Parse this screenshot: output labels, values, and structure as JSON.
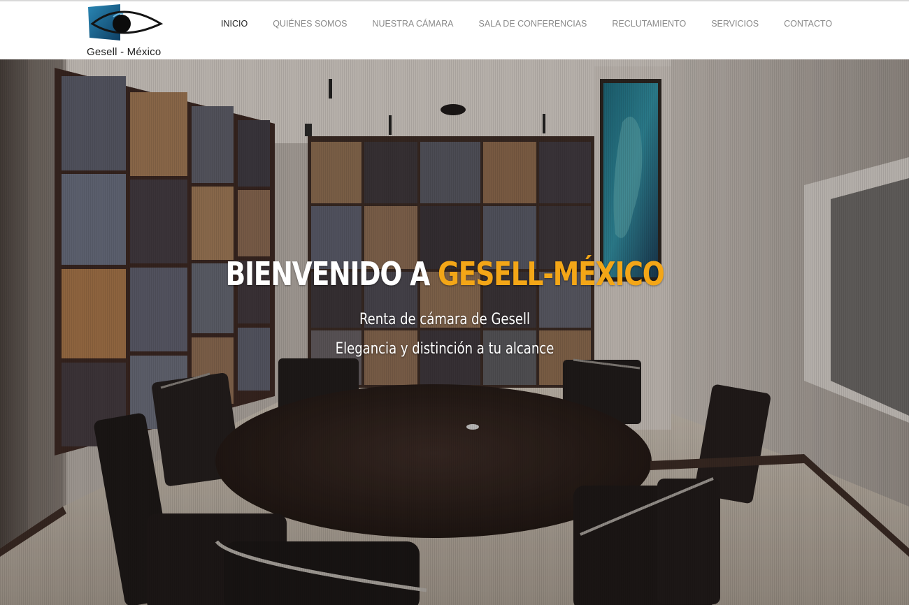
{
  "logo": {
    "text": "Gesell - México",
    "icon": "eye-logo-icon"
  },
  "nav": {
    "items": [
      {
        "label": "INICIO",
        "active": true
      },
      {
        "label": "QUIÉNES SOMOS",
        "active": false
      },
      {
        "label": "NUESTRA CÁMARA",
        "active": false
      },
      {
        "label": "SALA DE CONFERENCIAS",
        "active": false
      },
      {
        "label": "RECLUTAMIENTO",
        "active": false
      },
      {
        "label": "SERVICIOS",
        "active": false
      },
      {
        "label": "CONTACTO",
        "active": false
      }
    ]
  },
  "hero": {
    "title_prefix": "BIENVENIDO A ",
    "title_accent": "GESELL-MÉXICO",
    "line1": "Renta de cámara de Gesell",
    "line2": "Elegancia y distinción a tu alcance",
    "background": "conference-room-photo"
  },
  "colors": {
    "accent": "#f3a617",
    "nav_text": "#8a8a8a",
    "nav_active": "#222222",
    "logo_blue": "#1b5f8a"
  }
}
